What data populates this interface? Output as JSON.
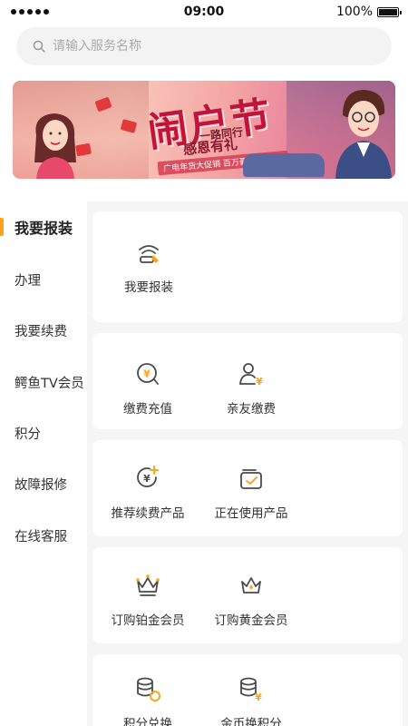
{
  "status_bar": {
    "time": "09:00",
    "battery": "100%",
    "battery_level": 1.0,
    "signal_bars": 5
  },
  "search": {
    "placeholder": "请输入服务名称",
    "icon": "search-icon"
  },
  "banner": {
    "title": "闹户节",
    "subtitle_line1": "一路同行",
    "subtitle_line2": "感恩有礼",
    "strip": "广电年货大促销 百万豪礼抽不停!",
    "colors": {
      "title": "#c2143a",
      "accent": "#e5799b"
    }
  },
  "sidebar": {
    "items": [
      {
        "label": "我要报装",
        "active": true
      },
      {
        "label": "办理",
        "active": false
      },
      {
        "label": "我要续费",
        "active": false
      },
      {
        "label": "鳄鱼TV会员",
        "active": false
      },
      {
        "label": "积分",
        "active": false
      },
      {
        "label": "故障报修",
        "active": false
      },
      {
        "label": "在线客服",
        "active": false
      }
    ],
    "accent_color": "#ffa31a"
  },
  "cards": [
    {
      "items": [
        {
          "label": "我要报装",
          "icon": "broadband-install-icon"
        }
      ]
    },
    {
      "items": [
        {
          "label": "缴费充值",
          "icon": "yuan-payment-icon"
        },
        {
          "label": "亲友缴费",
          "icon": "family-payment-icon"
        }
      ]
    },
    {
      "items": [
        {
          "label": "推荐续费产品",
          "icon": "renew-product-icon"
        },
        {
          "label": "正在使用产品",
          "icon": "wallet-check-icon"
        }
      ]
    },
    {
      "items": [
        {
          "label": "订购铂金会员",
          "icon": "platinum-crown-icon"
        },
        {
          "label": "订购黄金会员",
          "icon": "gold-crown-icon"
        }
      ]
    },
    {
      "items": [
        {
          "label": "积分兑换",
          "icon": "coin-exchange-icon"
        },
        {
          "label": "金币换积分",
          "icon": "gold-coin-icon"
        }
      ]
    }
  ],
  "colors": {
    "accent": "#ffa31a",
    "icon_stroke": "#4a4a4a",
    "page_bg": "#f5f5f5"
  }
}
